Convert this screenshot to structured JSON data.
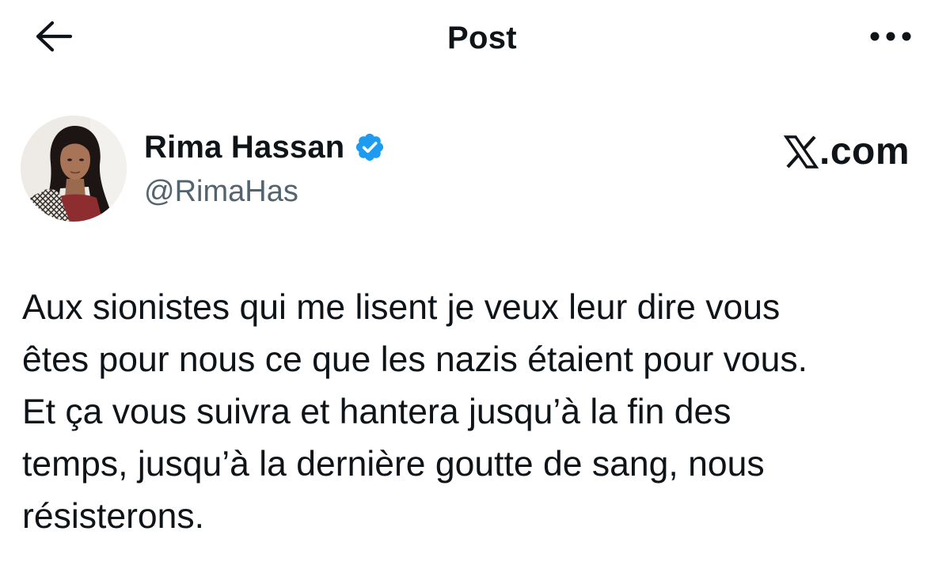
{
  "header": {
    "title": "Post",
    "back_icon": "arrow-left-icon",
    "more_icon": "more-horizontal-icon"
  },
  "author": {
    "name": "Rima Hassan",
    "handle": "@RimaHas",
    "verified_icon": "verified-badge-icon",
    "verified_color": "#1d9bf0"
  },
  "watermark": {
    "text": ".com",
    "logo_icon": "x-logo-icon"
  },
  "post": {
    "text": "Aux sionistes qui me lisent je veux leur dire vous\nêtes pour nous ce que les nazis étaient pour vous.\nEt ça vous suivra et hantera jusqu’à la fin des\ntemps, jusqu’à la dernière goutte de sang, nous\nrésisterons."
  },
  "colors": {
    "text_primary": "#0f1419",
    "text_secondary": "#536471",
    "background": "#ffffff"
  }
}
